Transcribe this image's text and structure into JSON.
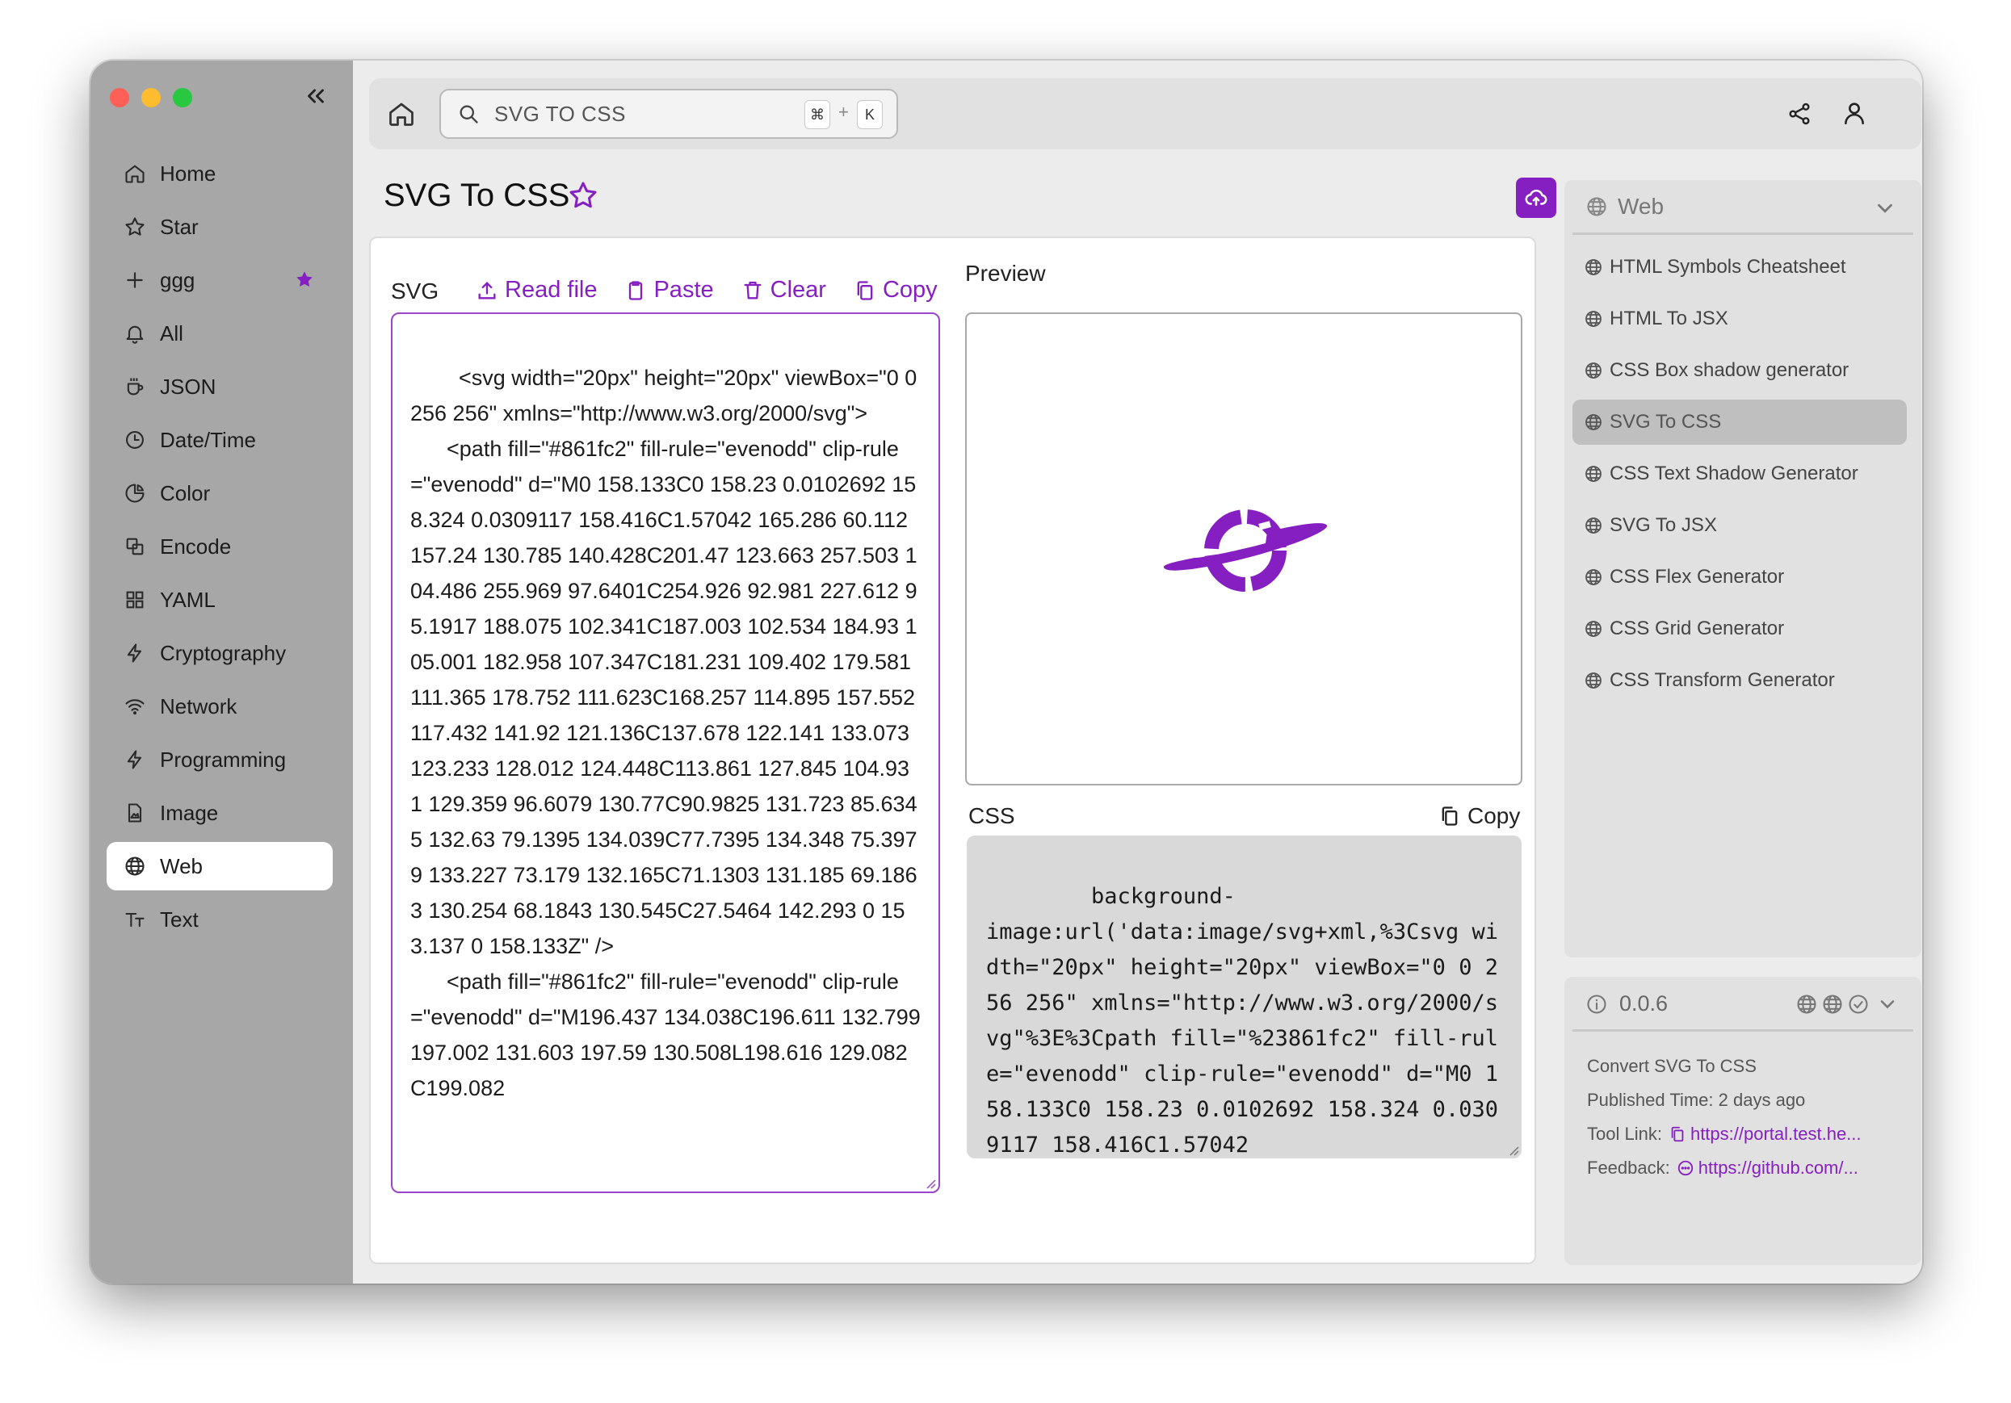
{
  "sidebar": {
    "items": [
      {
        "label": "Home",
        "icon": "home-icon"
      },
      {
        "label": "Star",
        "icon": "star-icon"
      },
      {
        "label": "ggg",
        "icon": "plus-icon"
      },
      {
        "label": "All",
        "icon": "bell-icon"
      },
      {
        "label": "JSON",
        "icon": "cup-icon"
      },
      {
        "label": "Date/Time",
        "icon": "clock-icon"
      },
      {
        "label": "Color",
        "icon": "pie-icon"
      },
      {
        "label": "Encode",
        "icon": "encode-icon"
      },
      {
        "label": "YAML",
        "icon": "grid-icon"
      },
      {
        "label": "Cryptography",
        "icon": "bolt-icon"
      },
      {
        "label": "Network",
        "icon": "wifi-icon"
      },
      {
        "label": "Programming",
        "icon": "bolt-icon"
      },
      {
        "label": "Image",
        "icon": "image-file-icon"
      },
      {
        "label": "Web",
        "icon": "globe-icon"
      },
      {
        "label": "Text",
        "icon": "text-icon"
      }
    ]
  },
  "search": {
    "text": "SVG TO CSS",
    "shortcut_cmd": "⌘",
    "shortcut_plus": "+",
    "shortcut_key": "K"
  },
  "page": {
    "title": "SVG To CSS"
  },
  "editor": {
    "label": "SVG",
    "actions": {
      "read_file": "Read file",
      "paste": "Paste",
      "clear": "Clear",
      "copy": "Copy"
    },
    "content": "<svg width=\"20px\" height=\"20px\" viewBox=\"0 0 256 256\" xmlns=\"http://www.w3.org/2000/svg\">\n      <path fill=\"#861fc2\" fill-rule=\"evenodd\" clip-rule=\"evenodd\" d=\"M0 158.133C0 158.23 0.0102692 158.324 0.0309117 158.416C1.57042 165.286 60.112 157.24 130.785 140.428C201.47 123.663 257.503 104.486 255.969 97.6401C254.926 92.981 227.612 95.1917 188.075 102.341C187.003 102.534 184.93 105.001 182.958 107.347C181.231 109.402 179.581 111.365 178.752 111.623C168.257 114.895 157.552 117.432 141.92 121.136C137.678 122.141 133.073 123.233 128.012 124.448C113.861 127.845 104.931 129.359 96.6079 130.77C90.9825 131.723 85.6345 132.63 79.1395 134.039C77.7395 134.348 75.3979 133.227 73.179 132.165C71.1303 131.185 69.1863 130.254 68.1843 130.545C27.5464 142.293 0 153.137 0 158.133Z\" />\n      <path fill=\"#861fc2\" fill-rule=\"evenodd\" clip-rule=\"evenodd\" d=\"M196.437 134.038C196.611 132.799 197.002 131.603 197.59 130.508L198.616 129.082C199.082"
  },
  "preview": {
    "label": "Preview"
  },
  "css": {
    "label": "CSS",
    "copy": "Copy",
    "content": "background-\nimage:url('data:image/svg+xml,%3Csvg width=\"20px\" height=\"20px\" viewBox=\"0 0 256 256\" xmlns=\"http://www.w3.org/2000/svg\"%3E%3Cpath fill=\"%23861fc2\" fill-rule=\"evenodd\" clip-rule=\"evenodd\" d=\"M0 158.133C0 158.23 0.0102692 158.324 0.0309117 158.416C1.57042"
  },
  "rightpanel": {
    "category": "Web",
    "items": [
      "HTML Symbols Cheatsheet",
      "HTML To JSX",
      "CSS Box shadow generator",
      "SVG To CSS",
      "CSS Text Shadow Generator",
      "SVG To JSX",
      "CSS Flex Generator",
      "CSS Grid Generator",
      "CSS Transform Generator"
    ]
  },
  "info": {
    "version": "0.0.6",
    "description": "Convert SVG To CSS",
    "published_label": "Published Time:",
    "published_value": "2 days ago",
    "tool_link_label": "Tool Link:",
    "tool_link_value": "https://portal.test.he...",
    "feedback_label": "Feedback:",
    "feedback_value": "https://github.com/..."
  },
  "colors": {
    "accent": "#861fc2"
  }
}
